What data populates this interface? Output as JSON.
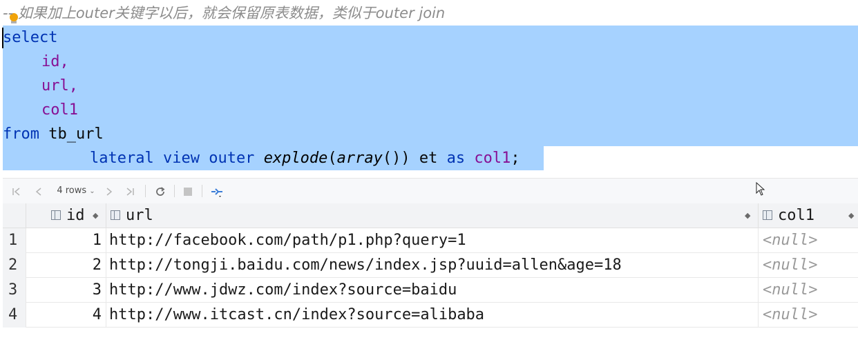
{
  "editor": {
    "comment": "-- 如果加上outer关键字以后，就会保留原表数据，类似于outer join",
    "kw_select": "select",
    "col_id": "id,",
    "col_url": "url,",
    "col_col1": "col1",
    "kw_from": "from",
    "table_name": " tb_url",
    "kw_lateral": "lateral",
    "kw_view": "view",
    "kw_outer": "outer",
    "fn_explode": "explode",
    "paren_open": "(",
    "fn_array": "array",
    "paren_close": "())",
    "alias": " et ",
    "kw_as": "as",
    "col1_alias": " col1",
    "semicolon": ";"
  },
  "toolbar": {
    "rows_label": "4 rows",
    "first_icon": "first-page-icon",
    "prev_icon": "prev-page-icon",
    "next_icon": "next-page-icon",
    "last_icon": "last-page-icon",
    "refresh_icon": "refresh-icon",
    "stop_icon": "stop-icon",
    "pin_icon": "pin-tab-icon"
  },
  "grid": {
    "columns": [
      "id",
      "url",
      "col1"
    ],
    "rows": [
      {
        "n": "1",
        "id": "1",
        "url": "http://facebook.com/path/p1.php?query=1",
        "col1": "<null>"
      },
      {
        "n": "2",
        "id": "2",
        "url": "http://tongji.baidu.com/news/index.jsp?uuid=allen&age=18",
        "col1": "<null>"
      },
      {
        "n": "3",
        "id": "3",
        "url": "http://www.jdwz.com/index?source=baidu",
        "col1": "<null>"
      },
      {
        "n": "4",
        "id": "4",
        "url": "http://www.itcast.cn/index?source=alibaba",
        "col1": "<null>"
      }
    ]
  },
  "colors": {
    "selection": "#a6d2ff",
    "keyword": "#0033b3",
    "field": "#871094",
    "comment": "#8c8c8c"
  }
}
